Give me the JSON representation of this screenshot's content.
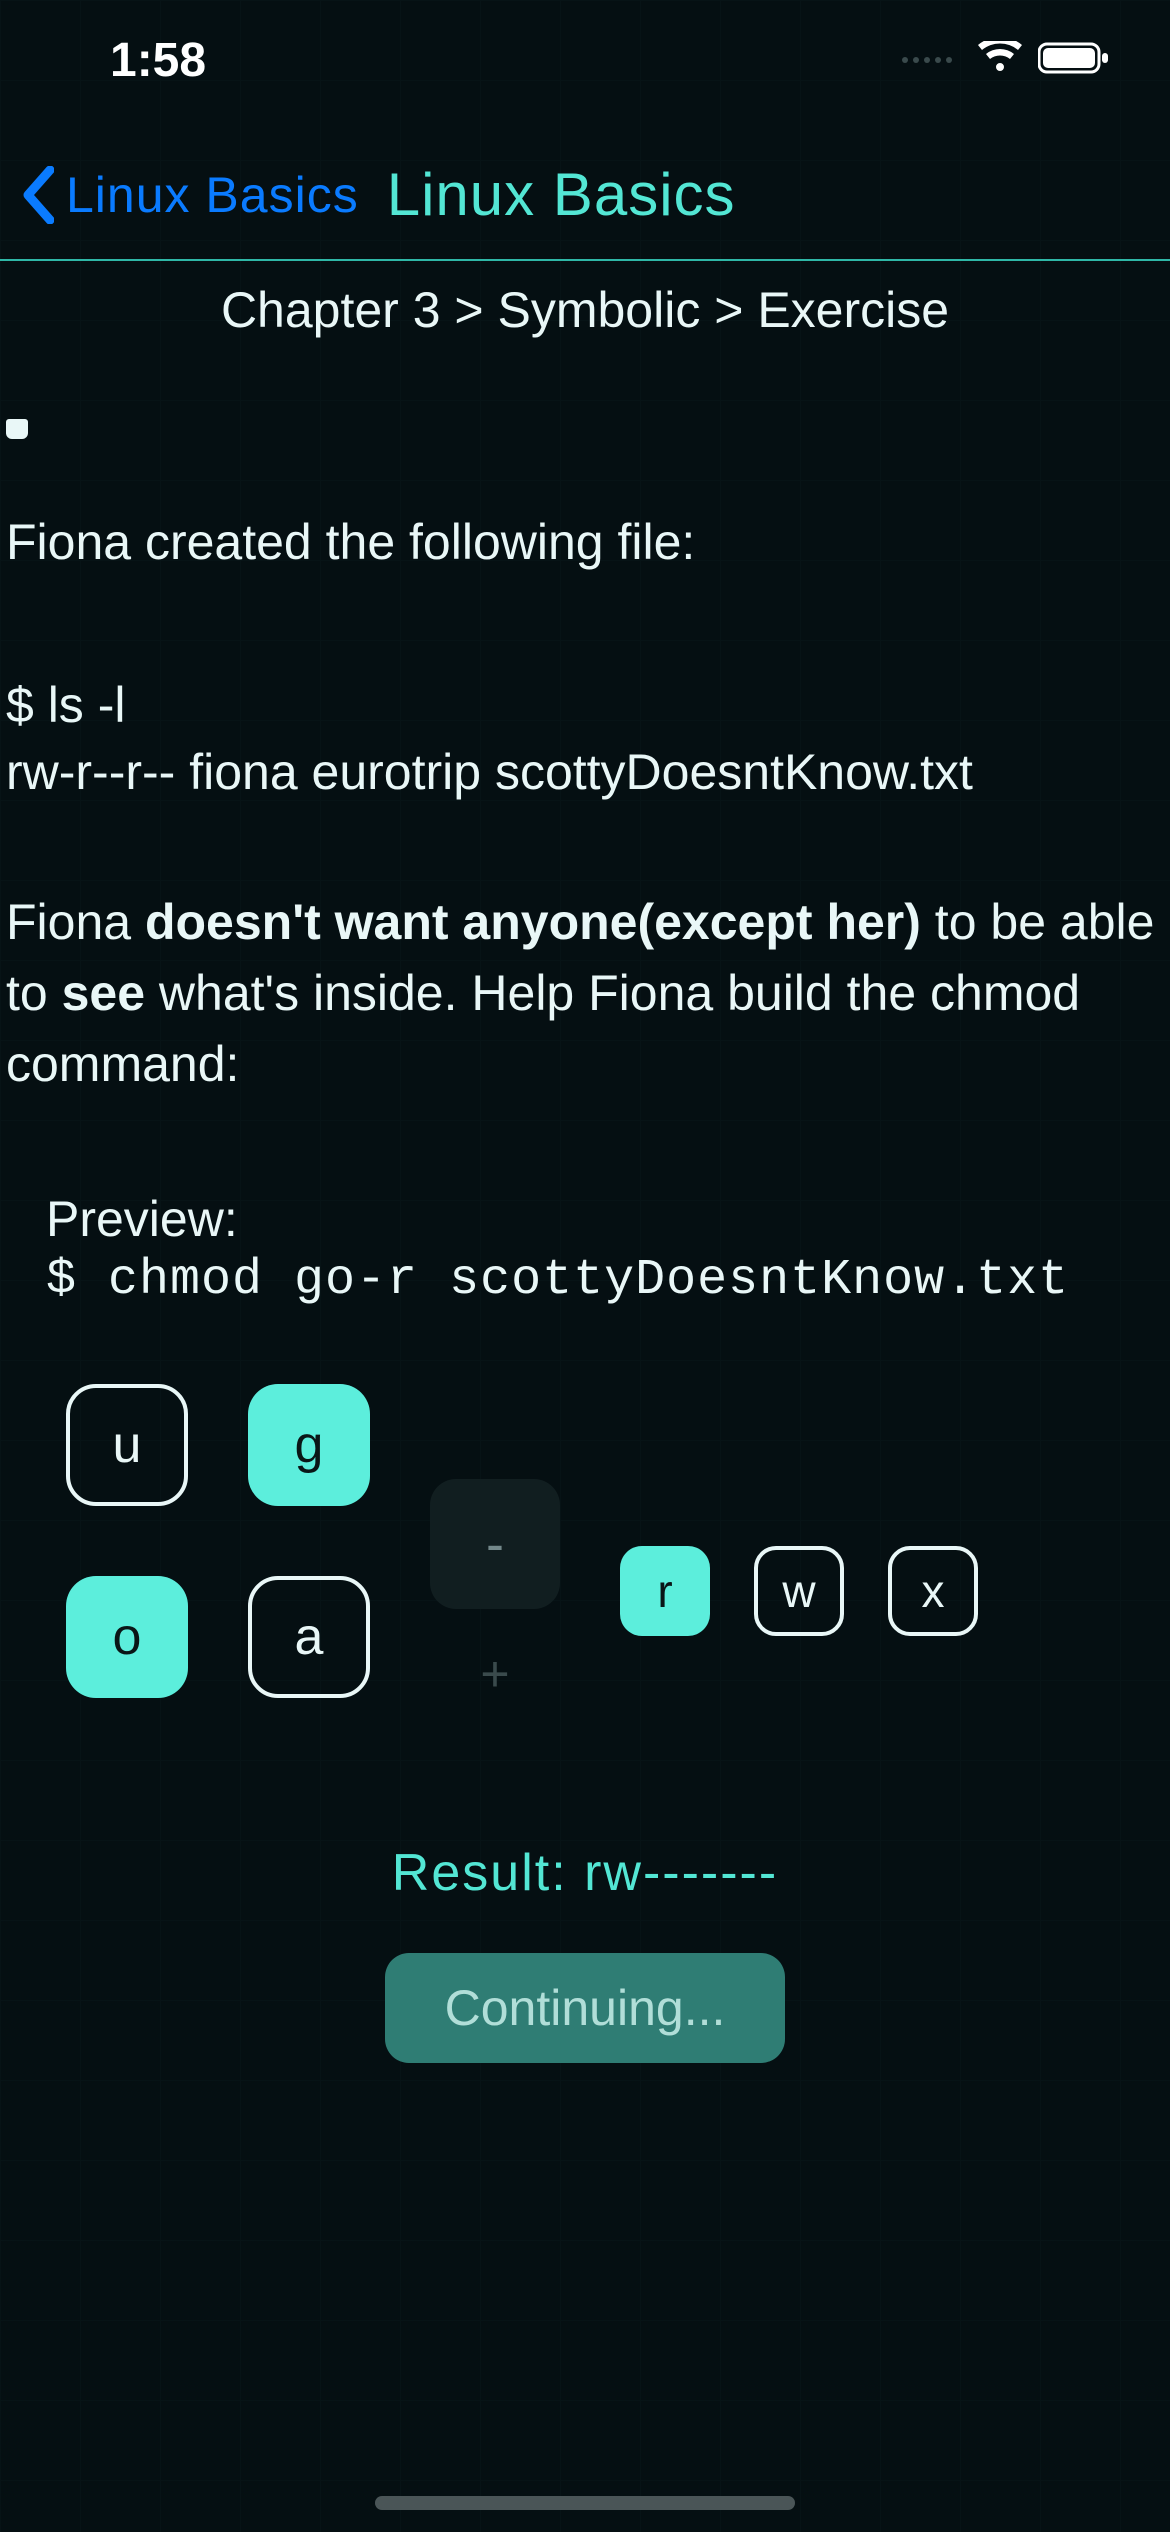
{
  "status": {
    "time": "1:58"
  },
  "nav": {
    "back_label": "Linux Basics",
    "title": "Linux Basics"
  },
  "breadcrumb": "Chapter 3 > Symbolic > Exercise",
  "exercise": {
    "intro": "Fiona created the following file:",
    "ls_cmd": "$ ls  -l",
    "ls_out": "rw-r--r--   fiona  eurotrip  scottyDoesntKnow.txt",
    "body_pre": "Fiona ",
    "body_bold1": "doesn't want anyone(except her)",
    "body_mid1": " to be able to ",
    "body_bold2": "see",
    "body_post": " what's inside. Help Fiona build the chmod command:",
    "preview_label": "Preview:",
    "preview_cmd": "$ chmod go-r scottyDoesntKnow.txt"
  },
  "builder": {
    "who": [
      {
        "key": "u",
        "label": "u",
        "selected": false
      },
      {
        "key": "g",
        "label": "g",
        "selected": true
      },
      {
        "key": "o",
        "label": "o",
        "selected": true
      },
      {
        "key": "a",
        "label": "a",
        "selected": false
      }
    ],
    "op": {
      "minus": "-",
      "plus": "+",
      "selected": "-"
    },
    "perms": [
      {
        "key": "r",
        "label": "r",
        "selected": true
      },
      {
        "key": "w",
        "label": "w",
        "selected": false
      },
      {
        "key": "x",
        "label": "x",
        "selected": false
      }
    ]
  },
  "result": {
    "label": "Result: ",
    "value": "rw-------"
  },
  "cta": {
    "label": "Continuing..."
  }
}
